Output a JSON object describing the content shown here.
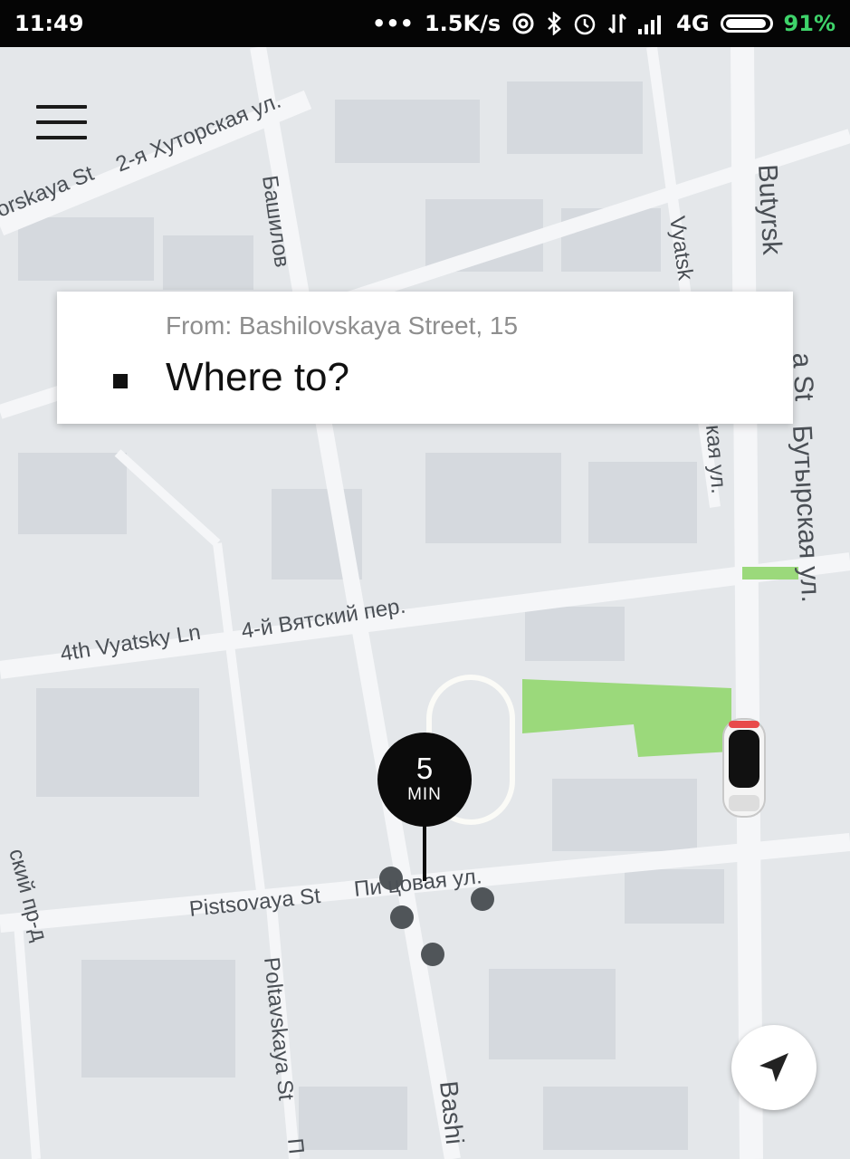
{
  "status_bar": {
    "time": "11:49",
    "dots": "•••",
    "speed": "1.5K/s",
    "network": "4G",
    "battery_percent": "91%",
    "icons": [
      "hotspot-icon",
      "bluetooth-icon",
      "alarm-icon",
      "data-arrows-icon",
      "signal-icon",
      "battery-icon"
    ]
  },
  "map": {
    "streets": [
      "orskaya St",
      "2-я Хуторская ул.",
      "Башилов",
      "Vyatsk",
      "Butyrsk",
      "а St",
      "Бутырская ул.",
      "кая ул.",
      "4th Vyatsky Ln",
      "4-й Вятский пер.",
      "Pistsovaya St",
      "Пи цовая ул.",
      "ский пр-д",
      "Poltavskaya St",
      "П",
      "Bashi"
    ],
    "eta": {
      "value": "5",
      "unit": "MIN"
    }
  },
  "search": {
    "from_text": "From: Bashilovskaya Street, 15",
    "where_placeholder": "Where to?"
  },
  "icons": {
    "menu": "hamburger-menu-icon",
    "destination": "square-bullet-icon",
    "locate": "navigation-arrow-icon",
    "car": "car-icon"
  },
  "colors": {
    "map_background": "#e4e7ea",
    "park": "#9bd97b",
    "pickup_marker": "#0b0b0b",
    "battery_text": "#3ed36a"
  }
}
